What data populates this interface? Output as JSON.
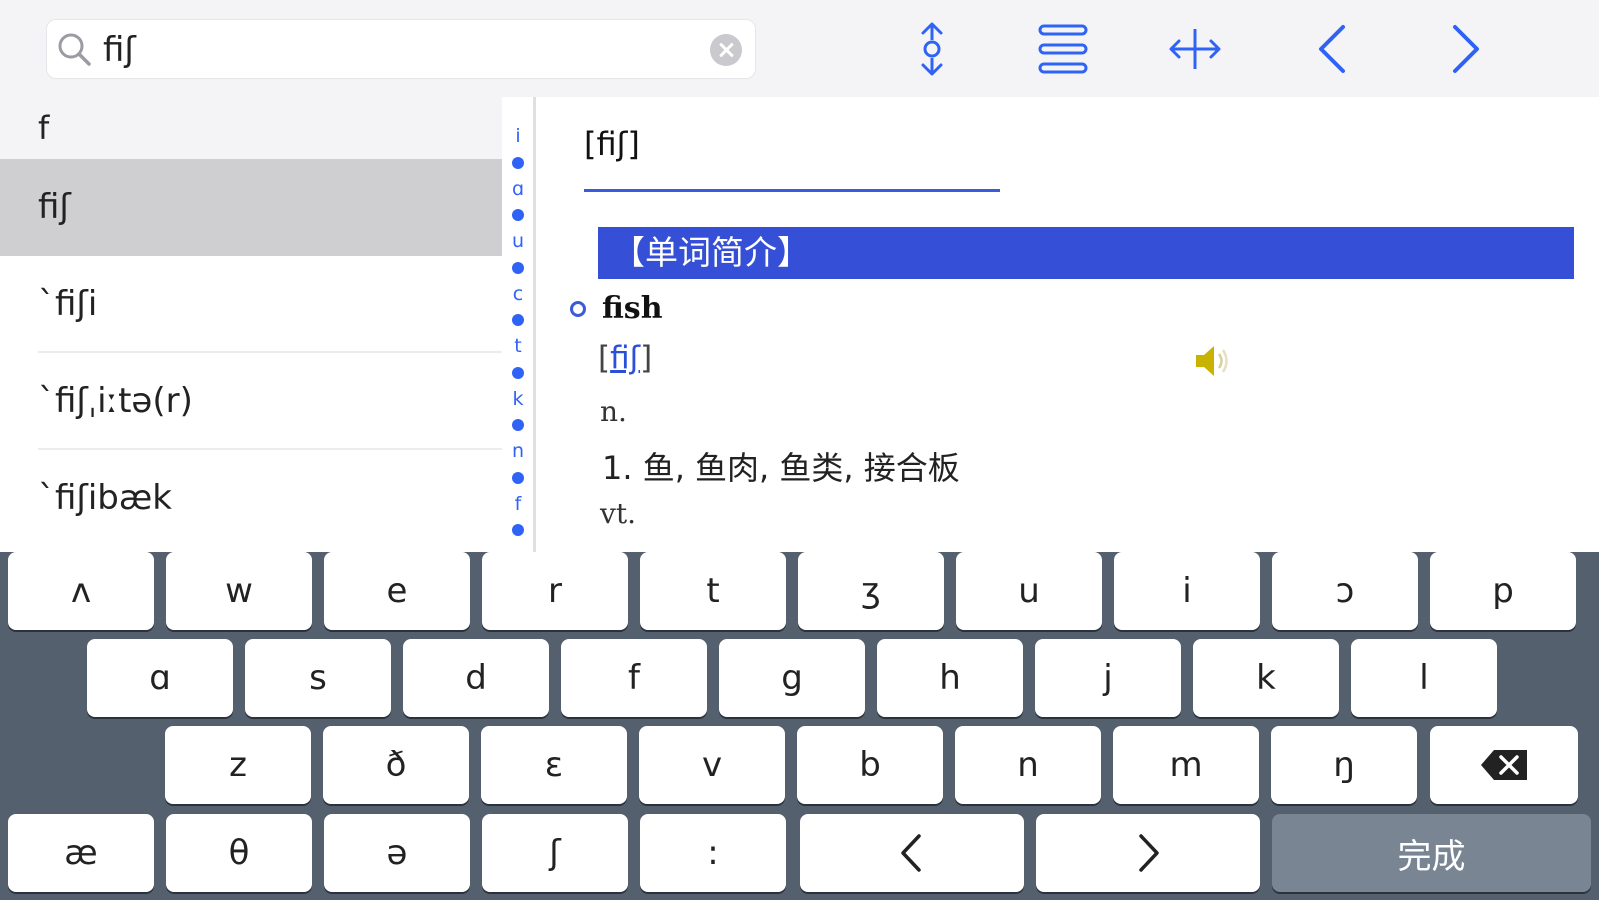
{
  "search": {
    "query": "fiʃ"
  },
  "toolbar": {
    "buttons": [
      {
        "name": "vertical-resize-button",
        "icon": "vertical-resize-icon"
      },
      {
        "name": "list-view-button",
        "icon": "list-lines-icon"
      },
      {
        "name": "horizontal-split-button",
        "icon": "horizontal-split-icon"
      },
      {
        "name": "previous-button",
        "icon": "chevron-left-icon"
      },
      {
        "name": "next-button",
        "icon": "chevron-right-icon"
      }
    ]
  },
  "word_list": {
    "section": "f",
    "items": [
      {
        "text": "fiʃ",
        "selected": true
      },
      {
        "text": "ˋfiʃi"
      },
      {
        "text": "ˋfiʃˌiːtə(r)"
      },
      {
        "text": "ˋfiʃibæk"
      }
    ]
  },
  "index_strip": [
    "i",
    "ɑ",
    "u",
    "c",
    "t",
    "k",
    "n",
    "f"
  ],
  "definition": {
    "headword": "[fiʃ]",
    "section_banner": "【单词简介】",
    "entry_word": "fish",
    "phonetic": "fiʃ",
    "pos_1": "n.",
    "sense_1": "1.  鱼, 鱼肉, 鱼类, 接合板",
    "pos_2": "vt."
  },
  "keyboard": {
    "rows": [
      [
        "ʌ",
        "w",
        "e",
        "r",
        "t",
        "ʒ",
        "u",
        "i",
        "ɔ",
        "p"
      ],
      [
        "ɑ",
        "s",
        "d",
        "f",
        "g",
        "h",
        "j",
        "k",
        "l"
      ],
      [
        "z",
        "ð",
        "ɛ",
        "v",
        "b",
        "n",
        "m",
        "ŋ"
      ],
      [
        "æ",
        "θ",
        "ə",
        "ʃ",
        ":"
      ]
    ],
    "done_label": "完成",
    "colors": {
      "background": "#55606e",
      "key": "#ffffff",
      "done_key": "#7a8593"
    }
  },
  "colors": {
    "accent": "#2f63f5",
    "banner": "#3550d6",
    "selected_row": "#cfcfd1"
  }
}
